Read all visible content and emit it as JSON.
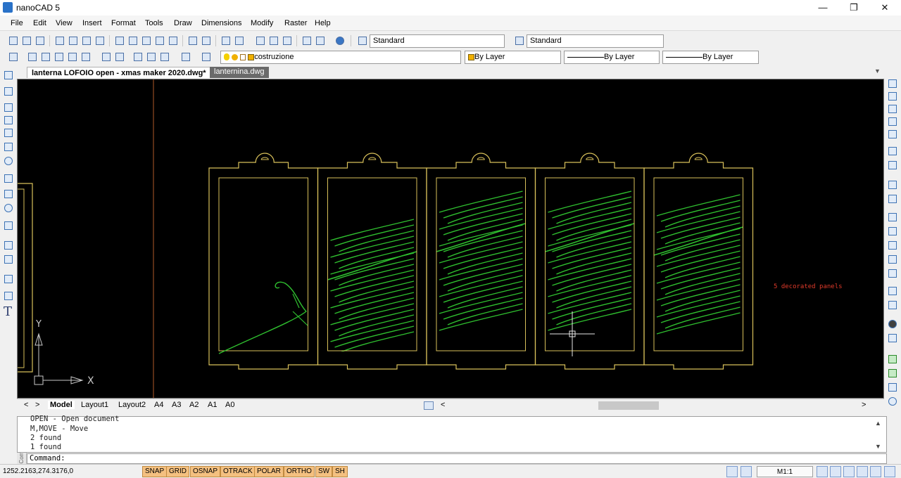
{
  "app": {
    "title": "nanoCAD 5"
  },
  "window_controls": {
    "minimize": "—",
    "restore": "❐",
    "close": "✕"
  },
  "menu": [
    "File",
    "Edit",
    "View",
    "Insert",
    "Format",
    "Tools",
    "Draw",
    "Dimensions",
    "Modify",
    "Raster",
    "Help"
  ],
  "toolbar1": {
    "text_style": "Standard",
    "dim_style": "Standard"
  },
  "toolbar2": {
    "layer": "costruzione",
    "color": "By Layer",
    "linetype": "By Layer",
    "lineweight": "By Layer"
  },
  "doc_tabs": [
    {
      "label": "lanterna LOFOIO open - xmas maker 2020.dwg*",
      "active": true
    },
    {
      "label": "lanternina.dwg",
      "active": false
    }
  ],
  "doc_tab_close": "✕",
  "canvas": {
    "annotation": "5 decorated panels",
    "ucs_y": "Y",
    "ucs_x": "X",
    "colors": {
      "background": "#000000",
      "outline": "#d8c05a",
      "leaf": "#2fbf2f",
      "annotation": "#e03a2a",
      "axis": "#c8c8c8"
    }
  },
  "layout_tabs": [
    "Model",
    "Layout1",
    "Layout2",
    "A4",
    "A3",
    "A2",
    "A1",
    "A0"
  ],
  "layout_nav": {
    "prev": "<",
    "next": ">"
  },
  "command_history": [
    "OPEN - Open document",
    "M,MOVE - Move",
    "2 found",
    "1 found"
  ],
  "command_prompt": "Command:",
  "cmd_grip_label": "Comm",
  "status": {
    "coords": "1252.2163,274.3176,0",
    "toggles": [
      "SNAP",
      "GRID",
      "OSNAP",
      "OTRACK",
      "POLAR",
      "ORTHO",
      "SW",
      "SH"
    ],
    "scale": "M1:1"
  }
}
